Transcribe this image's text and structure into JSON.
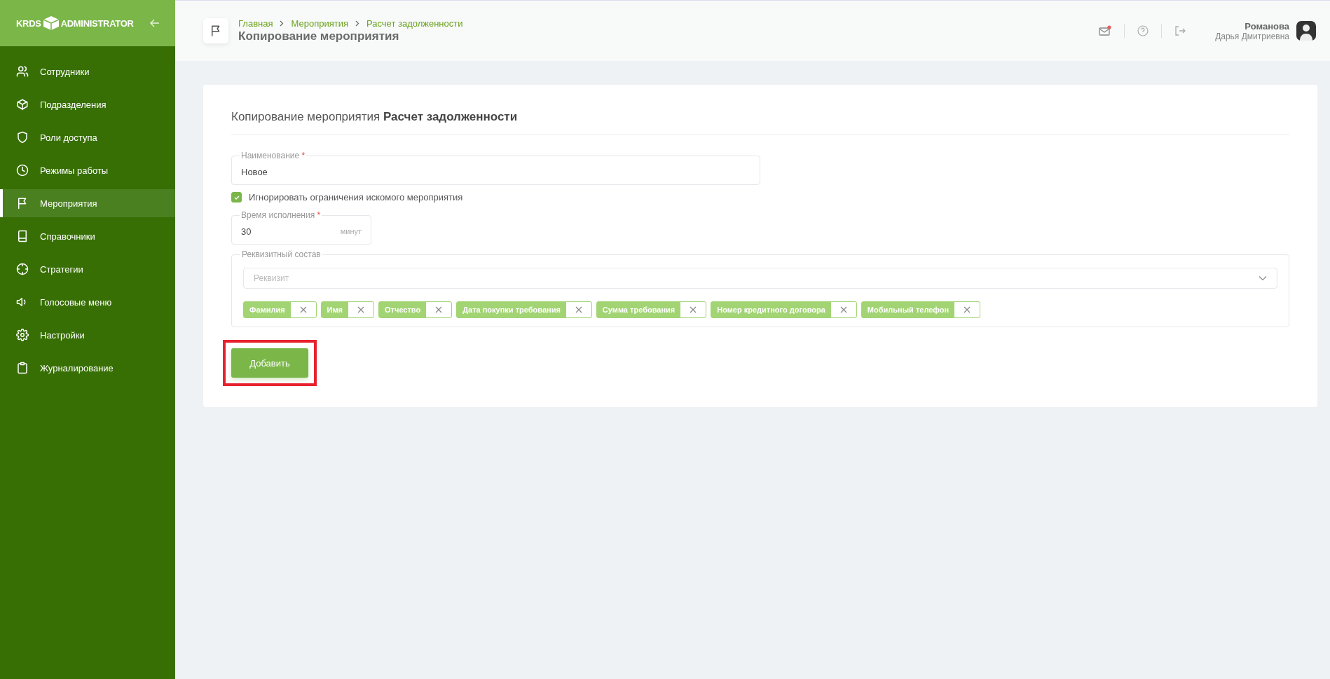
{
  "logo": {
    "left": "KRDS",
    "right": "ADMINISTRATOR"
  },
  "sidebar": {
    "items": [
      {
        "label": "Сотрудники",
        "selected": false
      },
      {
        "label": "Подразделения",
        "selected": false
      },
      {
        "label": "Роли доступа",
        "selected": false
      },
      {
        "label": "Режимы работы",
        "selected": false
      },
      {
        "label": "Мероприятия",
        "selected": true
      },
      {
        "label": "Справочники",
        "selected": false
      },
      {
        "label": "Стратегии",
        "selected": false
      },
      {
        "label": "Голосовые меню",
        "selected": false
      },
      {
        "label": "Настройки",
        "selected": false
      },
      {
        "label": "Журналирование",
        "selected": false
      }
    ]
  },
  "header": {
    "breadcrumbs": [
      "Главная",
      "Мероприятия",
      "Расчет задолженности"
    ],
    "title": "Копирование мероприятия",
    "mail_unread": true,
    "user": {
      "last_name": "Романова",
      "first_names": "Дарья Дмитриевна"
    }
  },
  "form": {
    "title": "Копирование мероприятия **Расчет задолженности**",
    "name_field": {
      "label": "Наименование",
      "required_mark": "*",
      "value": "Новое"
    },
    "ignore_checkbox": {
      "label": "Игнорировать ограничения искомого мероприятия",
      "checked": true
    },
    "time_field": {
      "label": "Время исполнения",
      "required_mark": "*",
      "value": "30",
      "unit": "минут"
    },
    "requisites": {
      "legend": "Реквизитный состав",
      "placeholder": "Реквизит",
      "tags": [
        "Фамилия",
        "Имя",
        "Отчество",
        "Дата покупки требования",
        "Сумма требования",
        "Номер кредитного договора",
        "Мобильный телефон"
      ]
    },
    "submit": {
      "label": "Добавить",
      "highlighted": true
    }
  }
}
